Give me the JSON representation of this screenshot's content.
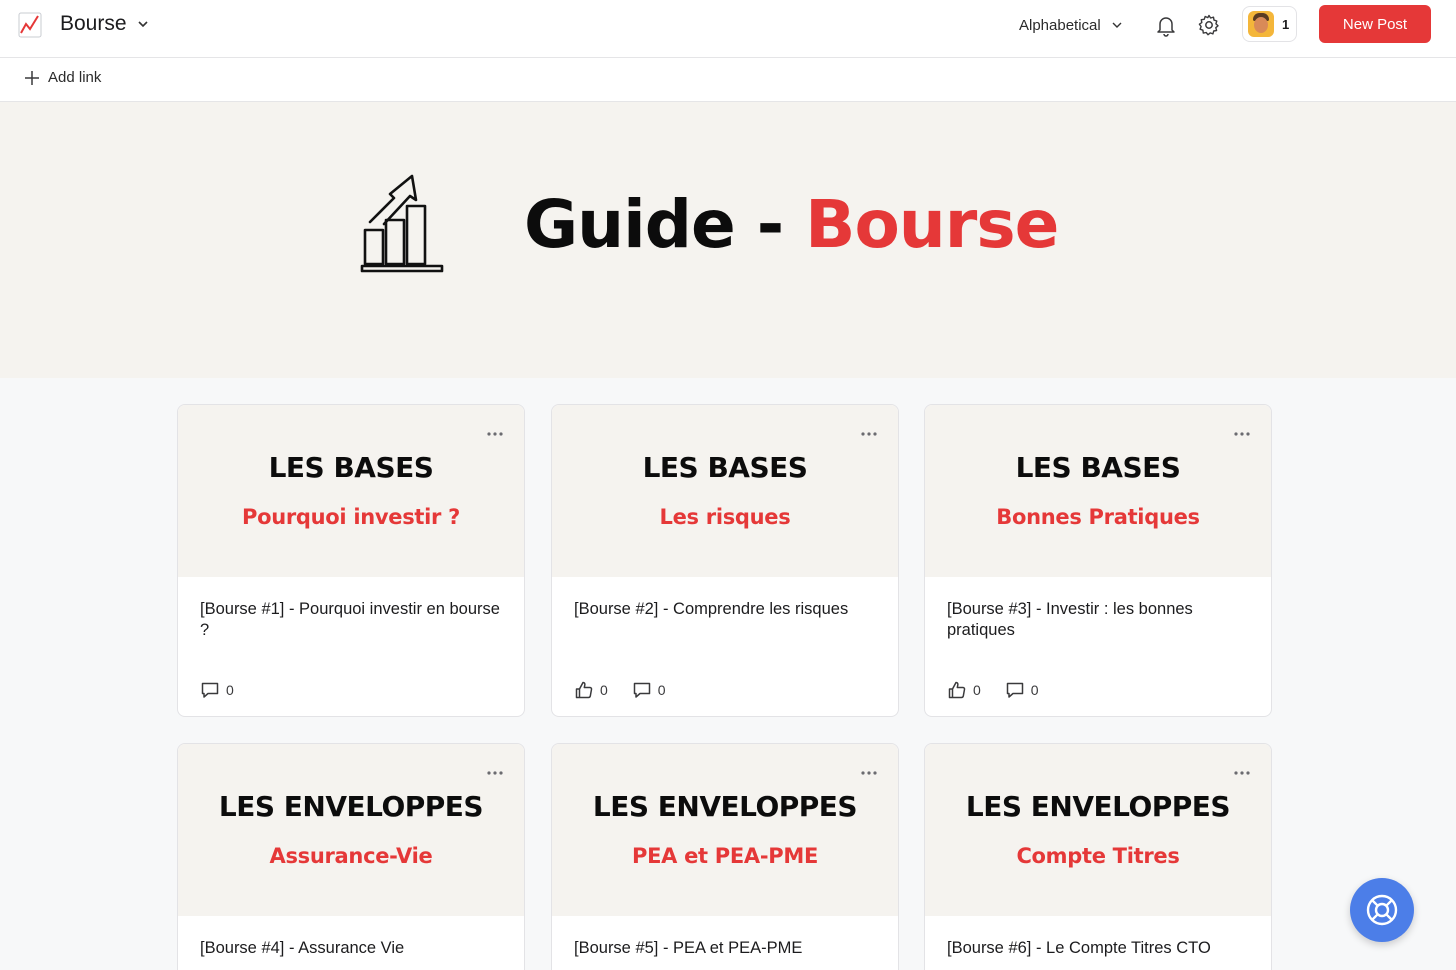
{
  "header": {
    "space_title": "Bourse",
    "sort_label": "Alphabetical",
    "members_count": "1",
    "new_post_label": "New Post"
  },
  "linkbar": {
    "add_link_label": "Add link"
  },
  "hero": {
    "title_black": "Guide - ",
    "title_red": "Bourse"
  },
  "posts": [
    {
      "cover_heading": "LES BASES",
      "cover_subtitle": "Pourquoi investir ?",
      "title": "[Bourse #1] - Pourquoi investir en bourse ?",
      "likes": null,
      "comments": "0"
    },
    {
      "cover_heading": "LES BASES",
      "cover_subtitle": "Les risques",
      "title": "[Bourse #2] - Comprendre les risques",
      "likes": "0",
      "comments": "0"
    },
    {
      "cover_heading": "LES BASES",
      "cover_subtitle": "Bonnes Pratiques",
      "title": "[Bourse #3] - Investir : les bonnes pratiques",
      "likes": "0",
      "comments": "0"
    },
    {
      "cover_heading": "LES ENVELOPPES",
      "cover_subtitle": "Assurance-Vie",
      "title": "[Bourse #4] - Assurance Vie"
    },
    {
      "cover_heading": "LES ENVELOPPES",
      "cover_subtitle": "PEA et PEA-PME",
      "title": "[Bourse #5] - PEA et PEA-PME"
    },
    {
      "cover_heading": "LES ENVELOPPES",
      "cover_subtitle": "Compte Titres",
      "title": "[Bourse #6] - Le Compte Titres CTO"
    }
  ],
  "colors": {
    "accent": "#e53838",
    "cover_bg": "#f5f3ef",
    "fab": "#4c7ee8"
  },
  "icons": [
    "chart-emoji-icon",
    "chevron-down-icon",
    "bell-icon",
    "gear-icon",
    "plus-icon",
    "growth-chart-icon",
    "more-dots-icon",
    "thumbs-up-icon",
    "comment-icon",
    "lifebuoy-icon"
  ]
}
